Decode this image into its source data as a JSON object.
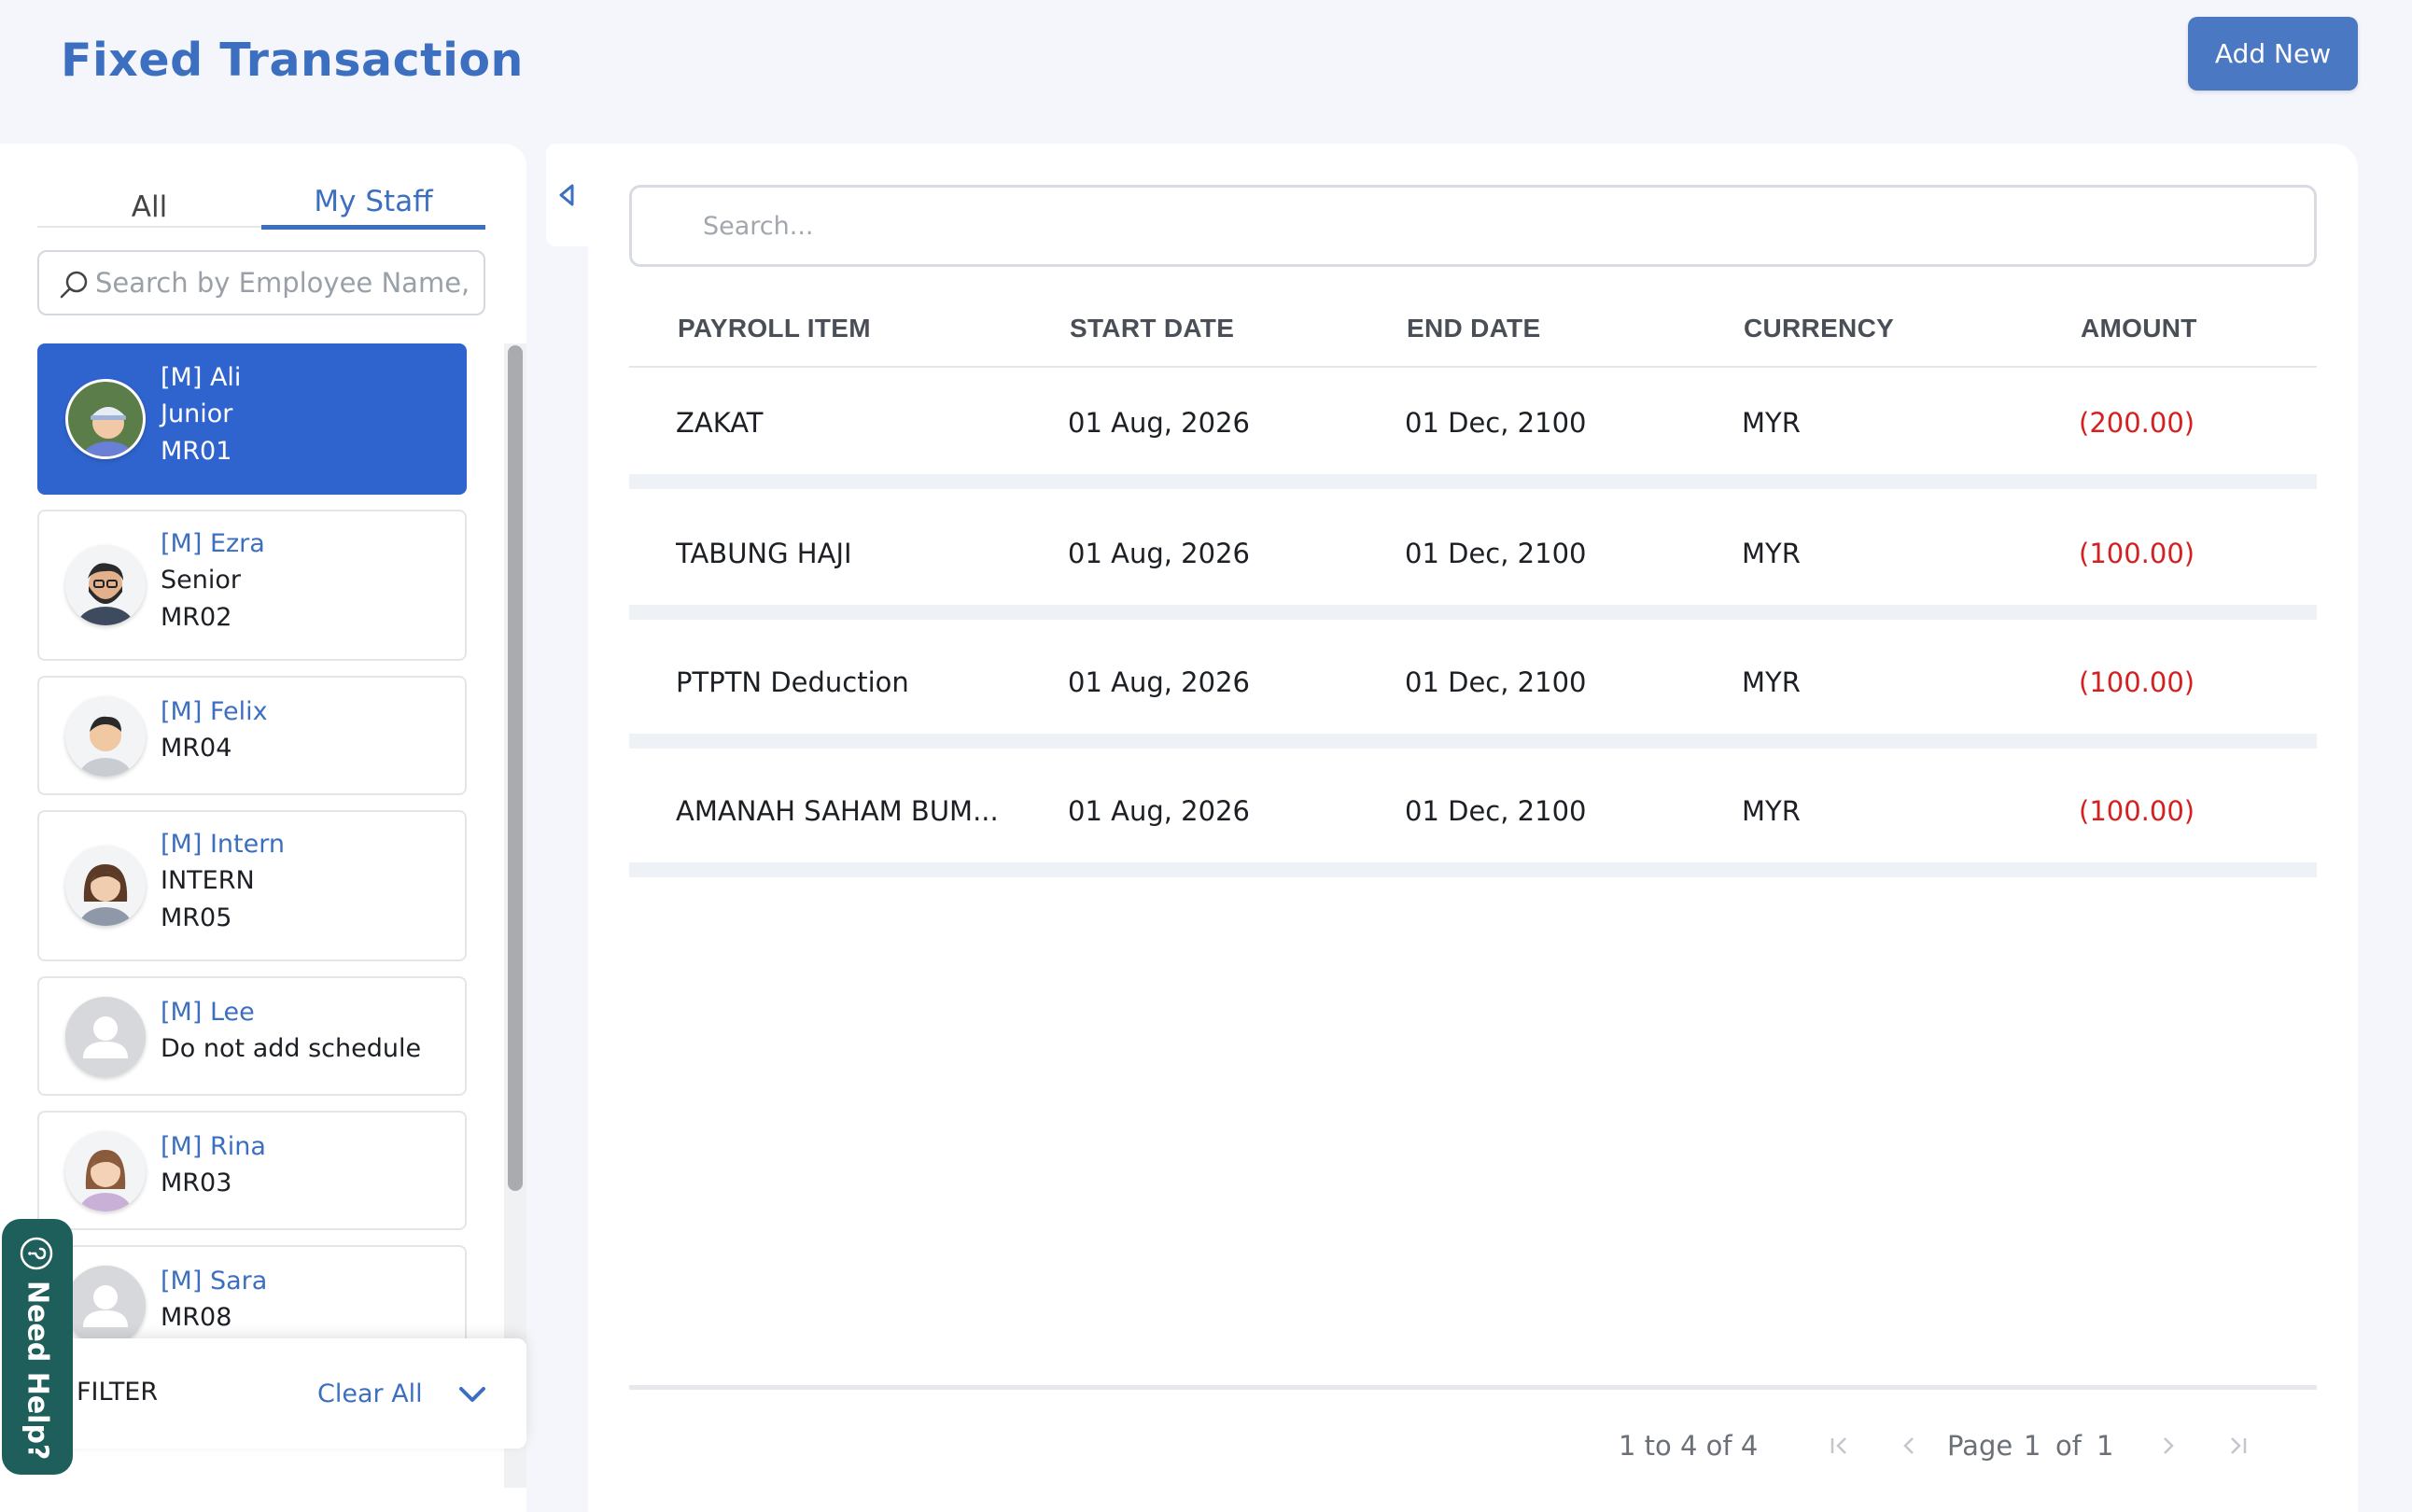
{
  "header": {
    "title": "Fixed Transaction",
    "add_new_label": "Add New"
  },
  "sidebar": {
    "tabs": [
      {
        "label": "All",
        "active": false
      },
      {
        "label": "My Staff",
        "active": true
      }
    ],
    "search_placeholder": "Search by Employee Name,",
    "employees": [
      {
        "name": "[M] Ali",
        "lines": [
          "Junior",
          "MR01"
        ],
        "avatar": "avatar-boy-cap",
        "active": true
      },
      {
        "name": "[M] Ezra",
        "lines": [
          "Senior",
          "MR02"
        ],
        "avatar": "avatar-bearded-man",
        "active": false
      },
      {
        "name": "[M] Felix",
        "lines": [
          "MR04"
        ],
        "avatar": "avatar-man",
        "active": false
      },
      {
        "name": "[M] Intern",
        "lines": [
          "INTERN",
          "MR05"
        ],
        "avatar": "avatar-woman",
        "active": false
      },
      {
        "name": "[M] Lee",
        "lines": [
          "Do not add schedule"
        ],
        "avatar": "avatar-placeholder",
        "active": false
      },
      {
        "name": "[M] Rina",
        "lines": [
          "MR03"
        ],
        "avatar": "avatar-girl",
        "active": false
      },
      {
        "name": "[M] Sara",
        "lines": [
          "MR08"
        ],
        "avatar": "avatar-placeholder",
        "active": false
      }
    ],
    "filter_label": "FILTER",
    "clear_all_label": "Clear All"
  },
  "need_help_label": "Need Help?",
  "table": {
    "search_placeholder": "Search...",
    "columns": [
      "PAYROLL ITEM",
      "START DATE",
      "END DATE",
      "CURRENCY",
      "AMOUNT"
    ],
    "rows": [
      {
        "payroll_item": "ZAKAT",
        "start_date": "01 Aug, 2026",
        "end_date": "01 Dec, 2100",
        "currency": "MYR",
        "amount": "(200.00)"
      },
      {
        "payroll_item": "TABUNG HAJI",
        "start_date": "01 Aug, 2026",
        "end_date": "01 Dec, 2100",
        "currency": "MYR",
        "amount": "(100.00)"
      },
      {
        "payroll_item": "PTPTN Deduction",
        "start_date": "01 Aug, 2026",
        "end_date": "01 Dec, 2100",
        "currency": "MYR",
        "amount": "(100.00)"
      },
      {
        "payroll_item": "AMANAH SAHAM BUM...",
        "start_date": "01 Aug, 2026",
        "end_date": "01 Dec, 2100",
        "currency": "MYR",
        "amount": "(100.00)"
      }
    ]
  },
  "pagination": {
    "range_text": "1 to 4 of 4",
    "page_label": "Page",
    "current_page": "1",
    "of_label": "of",
    "total_pages": "1"
  },
  "colors": {
    "accent": "#3d6fc0",
    "active_card": "#2f64cf",
    "negative_amount": "#d42020",
    "help_button": "#1f5f5b"
  }
}
